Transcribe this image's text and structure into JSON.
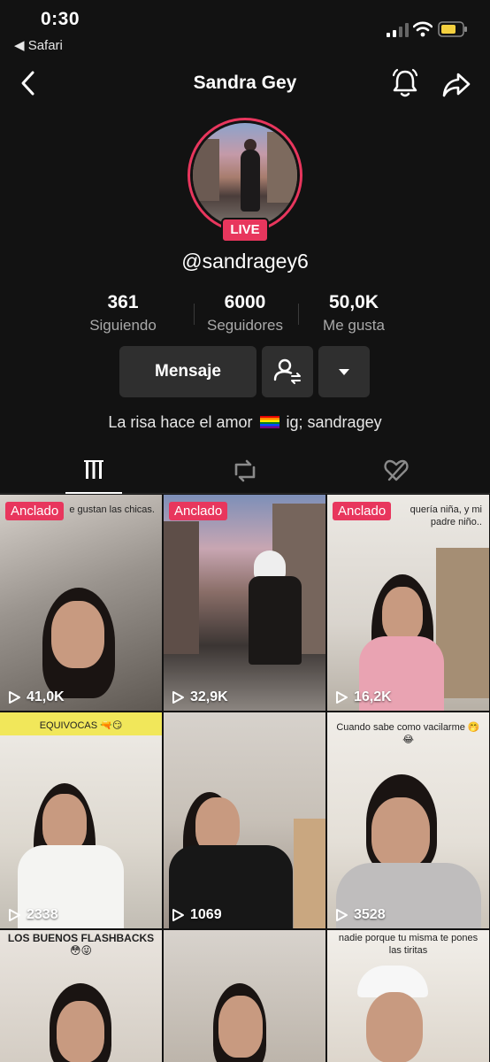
{
  "status_bar": {
    "time": "0:30",
    "back_app": "◀ Safari"
  },
  "header": {
    "title": "Sandra Gey"
  },
  "profile": {
    "live_label": "LIVE",
    "username": "@sandragey6",
    "stats": [
      {
        "value": "361",
        "label": "Siguiendo"
      },
      {
        "value": "6000",
        "label": "Seguidores"
      },
      {
        "value": "50,0K",
        "label": "Me gusta"
      }
    ],
    "message_button": "Mensaje",
    "bio_before": "La risa hace el amor",
    "bio_after": "ig; sandragey"
  },
  "grid": {
    "pinned_label": "Anclado",
    "tiles": [
      {
        "views": "41,0K",
        "pinned": true,
        "caption": "e gustan las chicas."
      },
      {
        "views": "32,9K",
        "pinned": true,
        "caption": ""
      },
      {
        "views": "16,2K",
        "pinned": true,
        "caption": "quería niña, y mi padre niño.."
      },
      {
        "views": "2338",
        "pinned": false,
        "caption": "EQUIVOCAS 🔫😏"
      },
      {
        "views": "1069",
        "pinned": false,
        "caption": ""
      },
      {
        "views": "3528",
        "pinned": false,
        "caption": "Cuando sabe como vacilarme 🤭😂"
      },
      {
        "views": "",
        "pinned": false,
        "caption": "LOS BUENOS FLASHBACKS 😳😜"
      },
      {
        "views": "",
        "pinned": false,
        "caption": ""
      },
      {
        "views": "",
        "pinned": false,
        "caption": "nadie porque tu misma te pones las tiritas"
      }
    ]
  },
  "colors": {
    "accent": "#e8365d",
    "background": "#121212",
    "button": "#2f2f2f"
  }
}
